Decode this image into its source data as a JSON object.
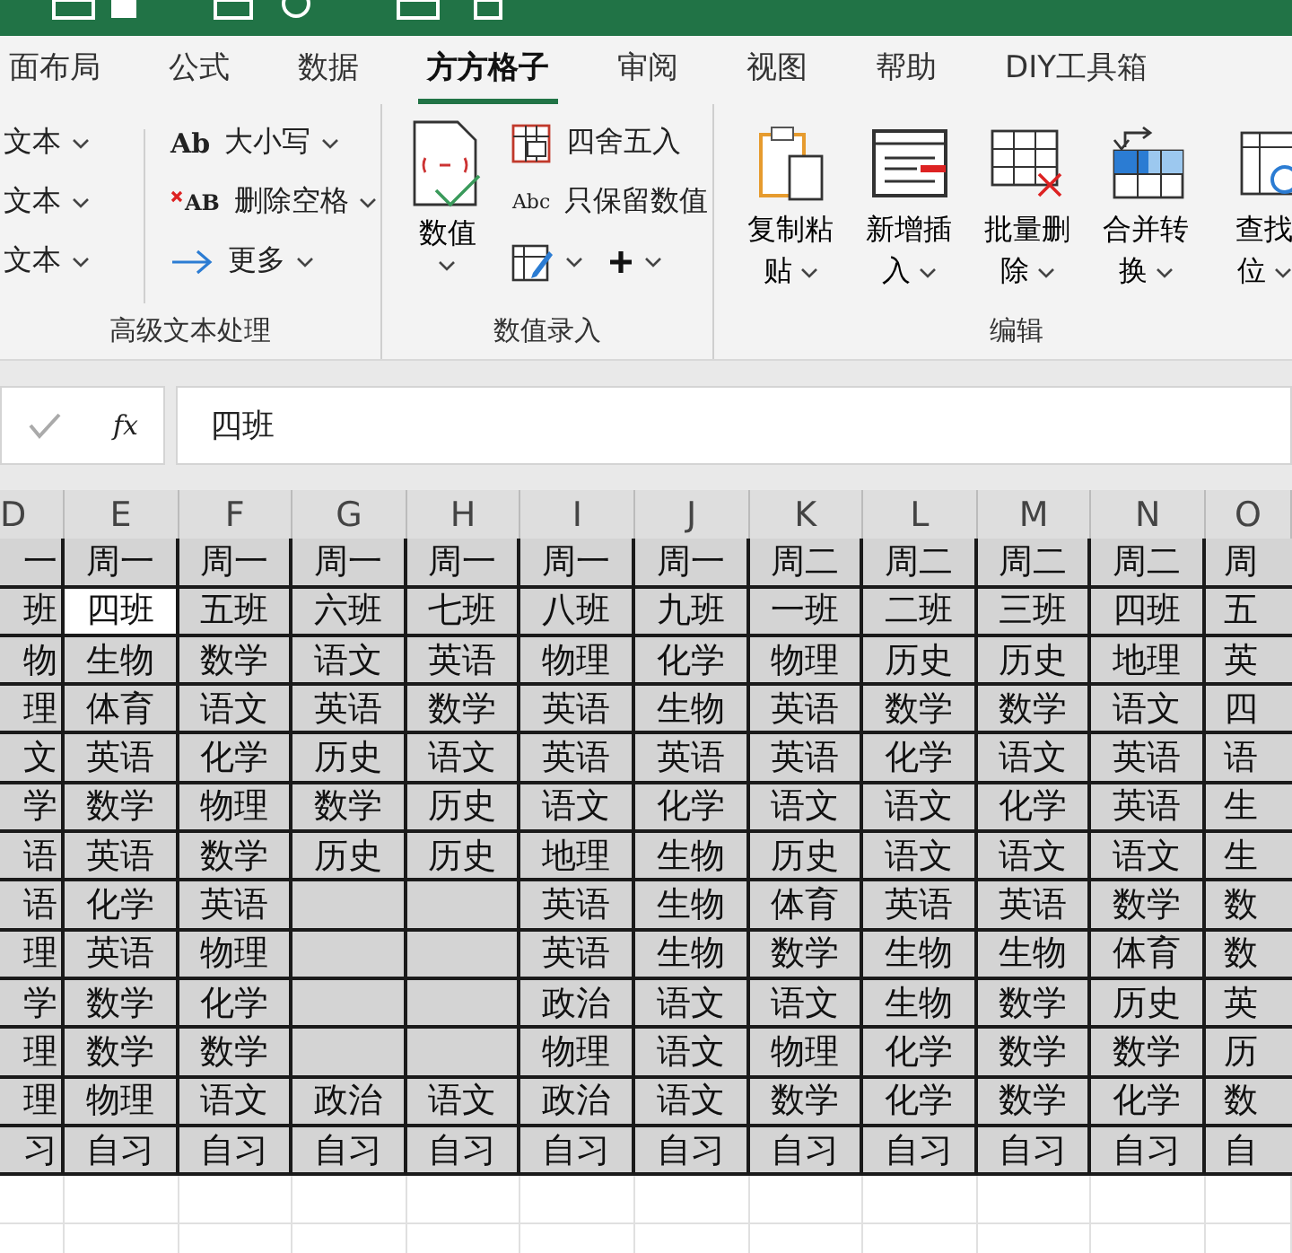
{
  "tabs": [
    {
      "label": "面布局",
      "selected": false
    },
    {
      "label": "公式",
      "selected": false
    },
    {
      "label": "数据",
      "selected": false
    },
    {
      "label": "方方格子",
      "selected": true
    },
    {
      "label": "审阅",
      "selected": false
    },
    {
      "label": "视图",
      "selected": false
    },
    {
      "label": "帮助",
      "selected": false
    },
    {
      "label": "DIY工具箱",
      "selected": false
    }
  ],
  "ribbon": {
    "text_group": {
      "title": "高级文本处理",
      "left_items": [
        "文本",
        "文本",
        "文本"
      ],
      "right_items": [
        {
          "kind": "case",
          "icon_text": "Ab",
          "label": "大小写"
        },
        {
          "kind": "trim",
          "icon_text": "AB",
          "label": "删除空格"
        },
        {
          "kind": "more",
          "label": "更多"
        }
      ]
    },
    "number_group": {
      "title": "数值录入",
      "big_button": "数值",
      "items": [
        {
          "kind": "round",
          "label": "四舍五入"
        },
        {
          "kind": "abc",
          "icon_text": "Abc",
          "label": "只保留数值"
        }
      ],
      "dropdowns": [
        {
          "kind": "edit"
        },
        {
          "kind": "plus"
        }
      ]
    },
    "edit_group": {
      "title": "编辑",
      "buttons": [
        {
          "kind": "paste",
          "lines": [
            "复制粘",
            "贴"
          ]
        },
        {
          "kind": "insert",
          "lines": [
            "新增插",
            "入"
          ]
        },
        {
          "kind": "delete",
          "lines": [
            "批量删",
            "除"
          ]
        },
        {
          "kind": "merge",
          "lines": [
            "合并转",
            "换"
          ]
        },
        {
          "kind": "find",
          "lines": [
            "查找",
            "位"
          ]
        }
      ]
    }
  },
  "formula_bar": {
    "fx": "fx",
    "value": "四班"
  },
  "sheet": {
    "columns": [
      "D",
      "E",
      "F",
      "G",
      "H",
      "I",
      "J",
      "K",
      "L",
      "M",
      "N",
      "O"
    ],
    "rows": [
      {
        "cells": [
          {
            "text": "一",
            "selected": false
          },
          {
            "text": "周一",
            "selected": false
          },
          {
            "text": "周一",
            "selected": false
          },
          {
            "text": "周一",
            "selected": false
          },
          {
            "text": "周一",
            "selected": false
          },
          {
            "text": "周一",
            "selected": false
          },
          {
            "text": "周一",
            "selected": false
          },
          {
            "text": "周二",
            "selected": false
          },
          {
            "text": "周二",
            "selected": false
          },
          {
            "text": "周二",
            "selected": false
          },
          {
            "text": "周二",
            "selected": false
          },
          {
            "text": "周",
            "selected": false
          }
        ]
      },
      {
        "cells": [
          {
            "text": "班",
            "selected": false
          },
          {
            "text": "四班",
            "selected": true
          },
          {
            "text": "五班",
            "selected": false
          },
          {
            "text": "六班",
            "selected": false
          },
          {
            "text": "七班",
            "selected": false
          },
          {
            "text": "八班",
            "selected": false
          },
          {
            "text": "九班",
            "selected": false
          },
          {
            "text": "一班",
            "selected": false
          },
          {
            "text": "二班",
            "selected": false
          },
          {
            "text": "三班",
            "selected": false
          },
          {
            "text": "四班",
            "selected": false
          },
          {
            "text": "五",
            "selected": false
          }
        ]
      },
      {
        "cells": [
          {
            "text": "物",
            "selected": false
          },
          {
            "text": "生物",
            "selected": false
          },
          {
            "text": "数学",
            "selected": false
          },
          {
            "text": "语文",
            "selected": false
          },
          {
            "text": "英语",
            "selected": false
          },
          {
            "text": "物理",
            "selected": false
          },
          {
            "text": "化学",
            "selected": false
          },
          {
            "text": "物理",
            "selected": false
          },
          {
            "text": "历史",
            "selected": false
          },
          {
            "text": "历史",
            "selected": false
          },
          {
            "text": "地理",
            "selected": false
          },
          {
            "text": "英",
            "selected": false
          }
        ]
      },
      {
        "cells": [
          {
            "text": "理",
            "selected": false
          },
          {
            "text": "体育",
            "selected": false
          },
          {
            "text": "语文",
            "selected": false
          },
          {
            "text": "英语",
            "selected": false
          },
          {
            "text": "数学",
            "selected": false
          },
          {
            "text": "英语",
            "selected": false
          },
          {
            "text": "生物",
            "selected": false
          },
          {
            "text": "英语",
            "selected": false
          },
          {
            "text": "数学",
            "selected": false
          },
          {
            "text": "数学",
            "selected": false
          },
          {
            "text": "语文",
            "selected": false
          },
          {
            "text": "四",
            "selected": false
          }
        ]
      },
      {
        "cells": [
          {
            "text": "文",
            "selected": false
          },
          {
            "text": "英语",
            "selected": false
          },
          {
            "text": "化学",
            "selected": false
          },
          {
            "text": "历史",
            "selected": false
          },
          {
            "text": "语文",
            "selected": false
          },
          {
            "text": "英语",
            "selected": false
          },
          {
            "text": "英语",
            "selected": false
          },
          {
            "text": "英语",
            "selected": false
          },
          {
            "text": "化学",
            "selected": false
          },
          {
            "text": "语文",
            "selected": false
          },
          {
            "text": "英语",
            "selected": false
          },
          {
            "text": "语",
            "selected": false
          }
        ]
      },
      {
        "cells": [
          {
            "text": "学",
            "selected": false
          },
          {
            "text": "数学",
            "selected": false
          },
          {
            "text": "物理",
            "selected": false
          },
          {
            "text": "数学",
            "selected": false
          },
          {
            "text": "历史",
            "selected": false
          },
          {
            "text": "语文",
            "selected": false
          },
          {
            "text": "化学",
            "selected": false
          },
          {
            "text": "语文",
            "selected": false
          },
          {
            "text": "语文",
            "selected": false
          },
          {
            "text": "化学",
            "selected": false
          },
          {
            "text": "英语",
            "selected": false
          },
          {
            "text": "生",
            "selected": false
          }
        ]
      },
      {
        "cells": [
          {
            "text": "语",
            "selected": false
          },
          {
            "text": "英语",
            "selected": false
          },
          {
            "text": "数学",
            "selected": false
          },
          {
            "text": "历史",
            "selected": false
          },
          {
            "text": "历史",
            "selected": false
          },
          {
            "text": "地理",
            "selected": false
          },
          {
            "text": "生物",
            "selected": false
          },
          {
            "text": "历史",
            "selected": false
          },
          {
            "text": "语文",
            "selected": false
          },
          {
            "text": "语文",
            "selected": false
          },
          {
            "text": "语文",
            "selected": false
          },
          {
            "text": "生",
            "selected": false
          }
        ]
      },
      {
        "cells": [
          {
            "text": "语",
            "selected": false
          },
          {
            "text": "化学",
            "selected": false
          },
          {
            "text": "英语",
            "selected": false
          },
          {
            "selected": false
          },
          {
            "selected": false
          },
          {
            "text": "英语",
            "selected": false
          },
          {
            "text": "生物",
            "selected": false
          },
          {
            "text": "体育",
            "selected": false
          },
          {
            "text": "英语",
            "selected": false
          },
          {
            "text": "英语",
            "selected": false
          },
          {
            "text": "数学",
            "selected": false
          },
          {
            "text": "数",
            "selected": false
          }
        ]
      },
      {
        "cells": [
          {
            "text": "理",
            "selected": false
          },
          {
            "text": "英语",
            "selected": false
          },
          {
            "text": "物理",
            "selected": false
          },
          {
            "selected": false
          },
          {
            "selected": false
          },
          {
            "text": "英语",
            "selected": false
          },
          {
            "text": "生物",
            "selected": false
          },
          {
            "text": "数学",
            "selected": false
          },
          {
            "text": "生物",
            "selected": false
          },
          {
            "text": "生物",
            "selected": false
          },
          {
            "text": "体育",
            "selected": false
          },
          {
            "text": "数",
            "selected": false
          }
        ]
      },
      {
        "cells": [
          {
            "text": "学",
            "selected": false
          },
          {
            "text": "数学",
            "selected": false
          },
          {
            "text": "化学",
            "selected": false
          },
          {
            "selected": false
          },
          {
            "selected": false
          },
          {
            "text": "政治",
            "selected": false
          },
          {
            "text": "语文",
            "selected": false
          },
          {
            "text": "语文",
            "selected": false
          },
          {
            "text": "生物",
            "selected": false
          },
          {
            "text": "数学",
            "selected": false
          },
          {
            "text": "历史",
            "selected": false
          },
          {
            "text": "英",
            "selected": false
          }
        ]
      },
      {
        "cells": [
          {
            "text": "理",
            "selected": false
          },
          {
            "text": "数学",
            "selected": false
          },
          {
            "text": "数学",
            "selected": false
          },
          {
            "selected": false
          },
          {
            "selected": false
          },
          {
            "text": "物理",
            "selected": false
          },
          {
            "text": "语文",
            "selected": false
          },
          {
            "text": "物理",
            "selected": false
          },
          {
            "text": "化学",
            "selected": false
          },
          {
            "text": "数学",
            "selected": false
          },
          {
            "text": "数学",
            "selected": false
          },
          {
            "text": "历",
            "selected": false
          }
        ]
      },
      {
        "cells": [
          {
            "text": "理",
            "selected": false
          },
          {
            "text": "物理",
            "selected": false
          },
          {
            "text": "语文",
            "selected": false
          },
          {
            "text": "政治",
            "selected": false
          },
          {
            "text": "语文",
            "selected": false
          },
          {
            "text": "政治",
            "selected": false
          },
          {
            "text": "语文",
            "selected": false
          },
          {
            "text": "数学",
            "selected": false
          },
          {
            "text": "化学",
            "selected": false
          },
          {
            "text": "数学",
            "selected": false
          },
          {
            "text": "化学",
            "selected": false
          },
          {
            "text": "数",
            "selected": false
          }
        ]
      },
      {
        "cells": [
          {
            "text": "习",
            "selected": false
          },
          {
            "text": "自习",
            "selected": false
          },
          {
            "text": "自习",
            "selected": false
          },
          {
            "text": "自习",
            "selected": false
          },
          {
            "text": "自习",
            "selected": false
          },
          {
            "text": "自习",
            "selected": false
          },
          {
            "text": "自习",
            "selected": false
          },
          {
            "text": "自习",
            "selected": false
          },
          {
            "text": "自习",
            "selected": false
          },
          {
            "text": "自习",
            "selected": false
          },
          {
            "text": "自习",
            "selected": false
          },
          {
            "text": "自",
            "selected": false
          }
        ]
      }
    ]
  }
}
